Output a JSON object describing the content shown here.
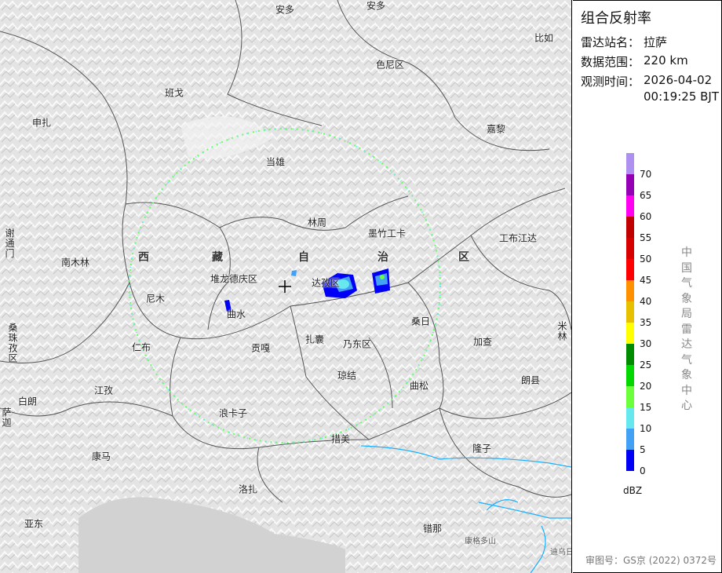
{
  "panel": {
    "title": "组合反射率",
    "station_label": "雷达站名：",
    "station": "拉萨",
    "range_label": "数据范围：",
    "range": "220 km",
    "time_label": "观测时间：",
    "date": "2026-04-02",
    "time": "00:19:25 BJT",
    "legend_unit": "dBZ",
    "legend": [
      {
        "value": "70",
        "color": "#ad90f0"
      },
      {
        "value": "65",
        "color": "#9600b4"
      },
      {
        "value": "60",
        "color": "#ff00f0"
      },
      {
        "value": "55",
        "color": "#c00000"
      },
      {
        "value": "50",
        "color": "#d60000"
      },
      {
        "value": "45",
        "color": "#ff0000"
      },
      {
        "value": "40",
        "color": "#ff9000"
      },
      {
        "value": "35",
        "color": "#e7c000"
      },
      {
        "value": "30",
        "color": "#ffff00"
      },
      {
        "value": "25",
        "color": "#008c00"
      },
      {
        "value": "20",
        "color": "#00d800"
      },
      {
        "value": "15",
        "color": "#6cff3c"
      },
      {
        "value": "10",
        "color": "#66e8ee"
      },
      {
        "value": "5",
        "color": "#42a0f5"
      },
      {
        "value": "0",
        "color": "#0000f6"
      }
    ],
    "organization": "中国气象局雷达气象中心",
    "map_approval": "审图号：GS京 (2022) 0372号"
  },
  "map": {
    "labels": [
      "安多",
      "安多",
      "比如",
      "色尼区",
      "班戈",
      "申扎",
      "嘉黎",
      "当雄",
      "林周",
      "墨竹工卡",
      "工布江达",
      "谢通门",
      "南木林",
      "西",
      "藏",
      "自",
      "治",
      "区",
      "堆龙德庆区",
      "达孜区",
      "尼木",
      "曲水",
      "桑日",
      "米林",
      "桑珠孜区",
      "仁布",
      "贡嘎",
      "扎囊",
      "乃东区",
      "加查",
      "琼结",
      "曲松",
      "朗县",
      "江孜",
      "白朗",
      "萨迦",
      "浪卡子",
      "措美",
      "隆子",
      "康马",
      "洛扎",
      "亚东",
      "错那",
      "康格多山",
      "迪乌日"
    ]
  }
}
